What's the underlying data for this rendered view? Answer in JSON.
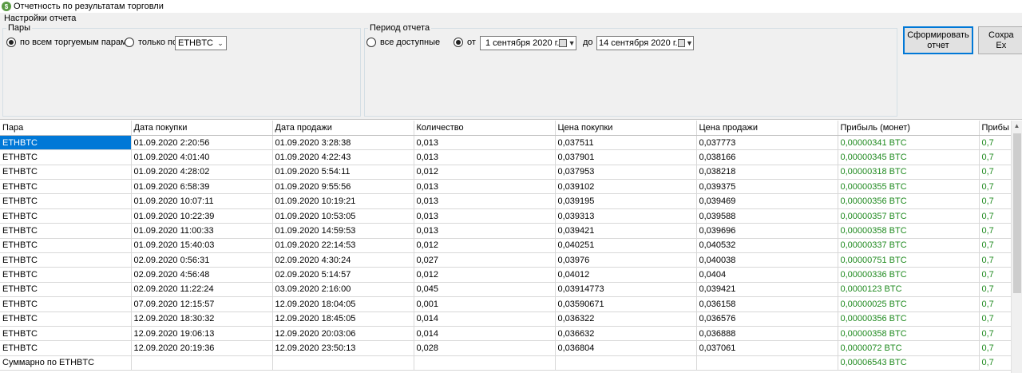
{
  "window": {
    "title": "Отчетность по результатам торговли",
    "icon": "app-logo-icon"
  },
  "settings": {
    "label": "Настройки отчета",
    "pairs": {
      "legend": "Пары",
      "all_label": "по всем торгуемым парам",
      "only_label": "только по:",
      "only_value": "ETHBTC"
    },
    "period": {
      "legend": "Период отчета",
      "all_label": "все доступные",
      "from_label": "от",
      "from_value": "1 сентября 2020 г.",
      "to_label": "до",
      "to_value": "14 сентября 2020 г."
    },
    "buttons": {
      "generate": "Сформировать\nотчет",
      "save": "Сохра\nEx"
    }
  },
  "table": {
    "columns": [
      "Пара",
      "Дата покупки",
      "Дата продажи",
      "Количество",
      "Цена покупки",
      "Цена продажи",
      "Прибыль (монет)",
      "Прибы"
    ],
    "rows": [
      [
        "ETHBTC",
        "01.09.2020 2:20:56",
        "01.09.2020 3:28:38",
        "0,013",
        "0,037511",
        "0,037773",
        "0,00000341 BTC",
        "0,7"
      ],
      [
        "ETHBTC",
        "01.09.2020 4:01:40",
        "01.09.2020 4:22:43",
        "0,013",
        "0,037901",
        "0,038166",
        "0,00000345 BTC",
        "0,7"
      ],
      [
        "ETHBTC",
        "01.09.2020 4:28:02",
        "01.09.2020 5:54:11",
        "0,012",
        "0,037953",
        "0,038218",
        "0,00000318 BTC",
        "0,7"
      ],
      [
        "ETHBTC",
        "01.09.2020 6:58:39",
        "01.09.2020 9:55:56",
        "0,013",
        "0,039102",
        "0,039375",
        "0,00000355 BTC",
        "0,7"
      ],
      [
        "ETHBTC",
        "01.09.2020 10:07:11",
        "01.09.2020 10:19:21",
        "0,013",
        "0,039195",
        "0,039469",
        "0,00000356 BTC",
        "0,7"
      ],
      [
        "ETHBTC",
        "01.09.2020 10:22:39",
        "01.09.2020 10:53:05",
        "0,013",
        "0,039313",
        "0,039588",
        "0,00000357 BTC",
        "0,7"
      ],
      [
        "ETHBTC",
        "01.09.2020 11:00:33",
        "01.09.2020 14:59:53",
        "0,013",
        "0,039421",
        "0,039696",
        "0,00000358 BTC",
        "0,7"
      ],
      [
        "ETHBTC",
        "01.09.2020 15:40:03",
        "01.09.2020 22:14:53",
        "0,012",
        "0,040251",
        "0,040532",
        "0,00000337 BTC",
        "0,7"
      ],
      [
        "ETHBTC",
        "02.09.2020 0:56:31",
        "02.09.2020 4:30:24",
        "0,027",
        "0,03976",
        "0,040038",
        "0,00000751 BTC",
        "0,7"
      ],
      [
        "ETHBTC",
        "02.09.2020 4:56:48",
        "02.09.2020 5:14:57",
        "0,012",
        "0,04012",
        "0,0404",
        "0,00000336 BTC",
        "0,7"
      ],
      [
        "ETHBTC",
        "02.09.2020 11:22:24",
        "03.09.2020 2:16:00",
        "0,045",
        "0,03914773",
        "0,039421",
        "0,0000123 BTC",
        "0,7"
      ],
      [
        "ETHBTC",
        "07.09.2020 12:15:57",
        "12.09.2020 18:04:05",
        "0,001",
        "0,03590671",
        "0,036158",
        "0,00000025 BTC",
        "0,7"
      ],
      [
        "ETHBTC",
        "12.09.2020 18:30:32",
        "12.09.2020 18:45:05",
        "0,014",
        "0,036322",
        "0,036576",
        "0,00000356 BTC",
        "0,7"
      ],
      [
        "ETHBTC",
        "12.09.2020 19:06:13",
        "12.09.2020 20:03:06",
        "0,014",
        "0,036632",
        "0,036888",
        "0,00000358 BTC",
        "0,7"
      ],
      [
        "ETHBTC",
        "12.09.2020 20:19:36",
        "12.09.2020 23:50:13",
        "0,028",
        "0,036804",
        "0,037061",
        "0,0000072 BTC",
        "0,7"
      ],
      [
        "Суммарно по ETHBTC",
        "",
        "",
        "",
        "",
        "",
        "0,00006543 BTC",
        "0,7"
      ]
    ]
  },
  "colors": {
    "selection": "#0078d7",
    "profit": "#1f8a1f",
    "app_icon": "#5a9a44"
  }
}
